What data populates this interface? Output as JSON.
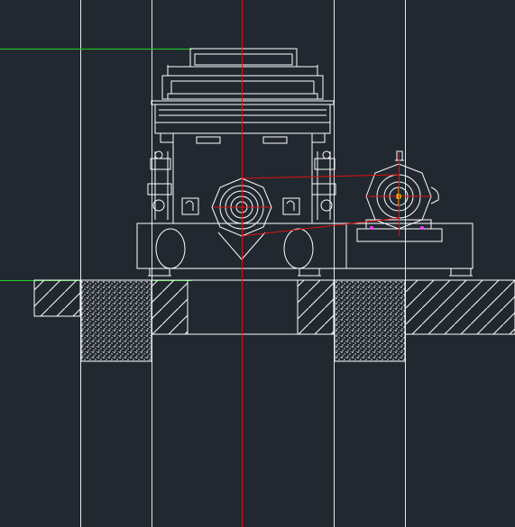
{
  "viewport": {
    "background": "#212830",
    "line_color": "#ffffff",
    "centerline_color": "#e01010",
    "level_line_color": "#1fd11f",
    "marker_color": "#e8e800",
    "accent_colors": [
      "#ff40ff",
      "#40ffff"
    ]
  },
  "drawing": {
    "subject": "crusher-and-motor-elevation",
    "text_labels": []
  }
}
